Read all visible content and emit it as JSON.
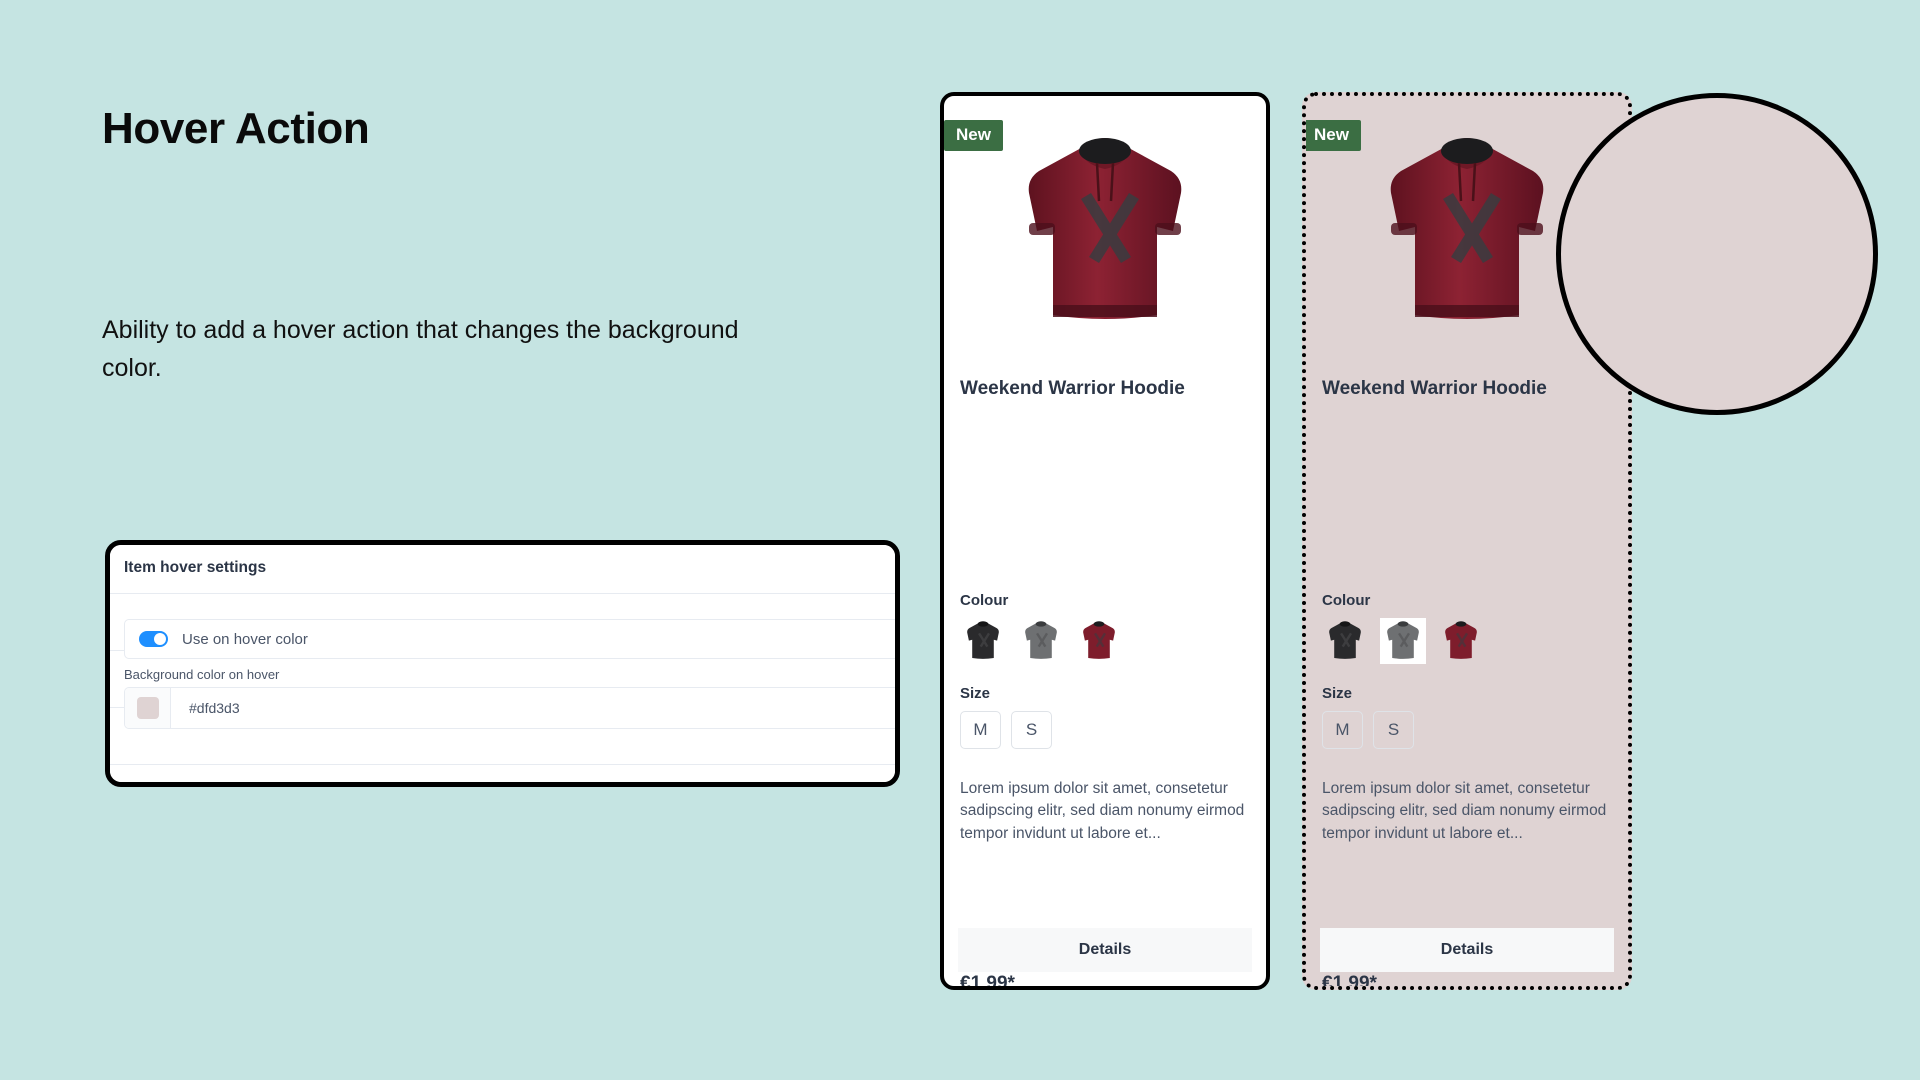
{
  "page": {
    "background_color": "#c5e4e2",
    "headline": "Hover Action",
    "description": "Ability to add a hover action that changes the background color."
  },
  "settings_panel": {
    "title": "Item hover settings",
    "toggle": {
      "label": "Use on hover color",
      "state": "on",
      "accent_color": "#1e8fff"
    },
    "color_field": {
      "label": "Background color on hover",
      "value": "#dfd3d3",
      "swatch_color": "#dfd3d3"
    }
  },
  "cards": [
    {
      "state": "default",
      "badge": "New",
      "title": "Weekend Warrior Hoodie",
      "colour_label": "Colour",
      "colours": [
        {
          "name": "black",
          "hex": "#2a2a2c",
          "selected": false
        },
        {
          "name": "grey",
          "hex": "#6e7072",
          "selected": false
        },
        {
          "name": "burgundy",
          "hex": "#7e1d2c",
          "selected": false
        }
      ],
      "size_label": "Size",
      "sizes": [
        "M",
        "S"
      ],
      "description": "Lorem ipsum dolor sit amet, consetetur sadipscing elitr, sed diam nonumy eirmod tempor invidunt ut labore et...",
      "price": "€1.99*",
      "details_label": "Details",
      "background_color": "#ffffff",
      "border_style": "solid"
    },
    {
      "state": "hover",
      "badge": "New",
      "title": "Weekend Warrior Hoodie",
      "colour_label": "Colour",
      "colours": [
        {
          "name": "black",
          "hex": "#2a2a2c",
          "selected": false
        },
        {
          "name": "grey",
          "hex": "#6e7072",
          "selected": true
        },
        {
          "name": "burgundy",
          "hex": "#7e1d2c",
          "selected": false
        }
      ],
      "size_label": "Size",
      "sizes": [
        "M",
        "S"
      ],
      "description": "Lorem ipsum dolor sit amet, consetetur sadipscing elitr, sed diam nonumy eirmod tempor invidunt ut labore et...",
      "price": "€1.99*",
      "details_label": "Details",
      "background_color": "#dfd3d3",
      "border_style": "dotted"
    }
  ],
  "annotation": {
    "shape": "circle",
    "fill_color": "#dfd3d3",
    "stroke_color": "#000000"
  }
}
